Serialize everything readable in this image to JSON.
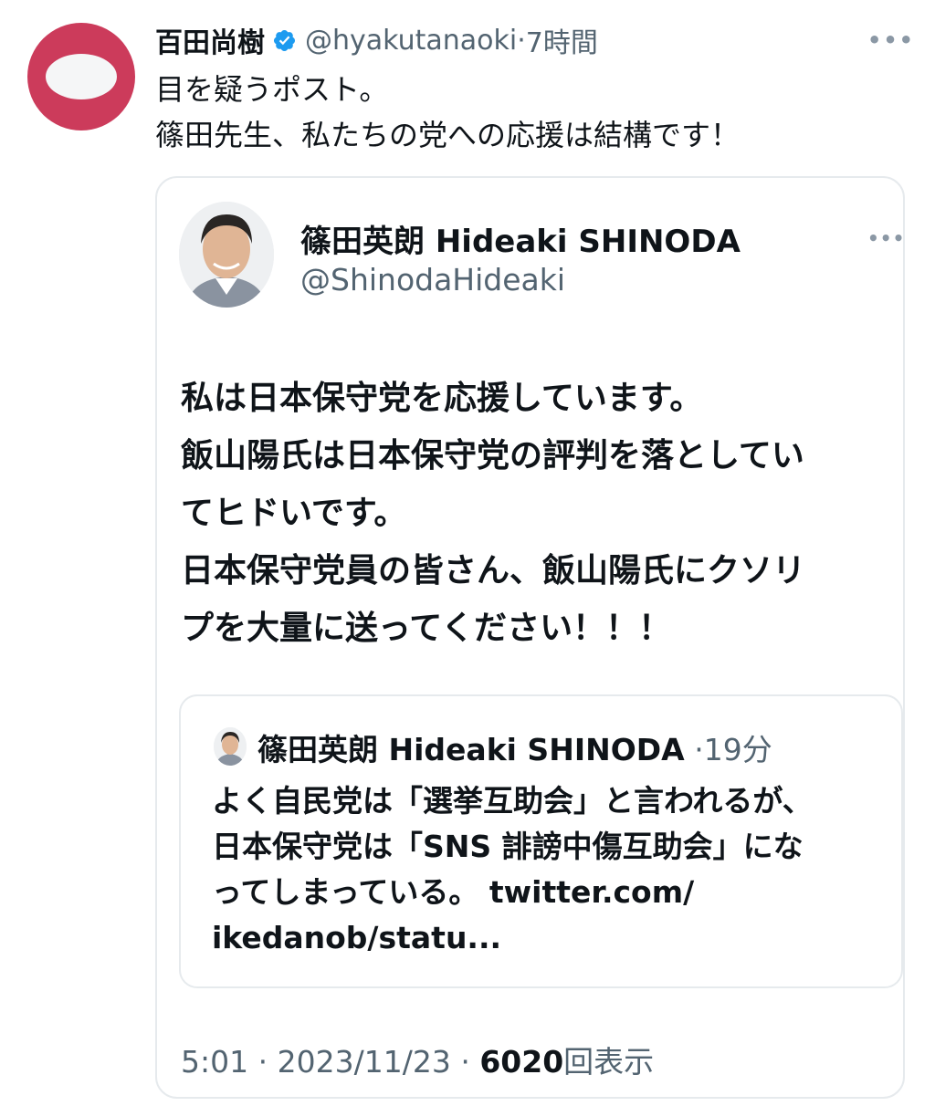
{
  "tweet": {
    "display_name": "百田尚樹",
    "handle": "@hyakutanaoki",
    "time": "7時間",
    "more_icon": "more-horizontal-icon",
    "verified_icon": "verified-badge-icon",
    "accent_color": "#1d9bf0",
    "text_lines": [
      "目を疑うポスト。",
      "篠田先生、私たちの党への応援は結構です！"
    ]
  },
  "quoted": {
    "display_name": "篠田英朗 Hideaki SHINODA",
    "handle": "@ShinodaHideaki",
    "more_icon": "more-horizontal-icon",
    "body_lines": [
      "私は日本保守党を応援しています。",
      "飯山陽氏は日本保守党の評判を落としてい",
      "てヒドいです。",
      "日本保守党員の皆さん、飯山陽氏にクソリ",
      "プを大量に送ってください！！！"
    ],
    "nested": {
      "display_name": "篠田英朗 Hideaki SHINODA",
      "time": "19分",
      "body_lines": [
        "よく自民党は「選挙互助会」と言われるが、",
        "日本保守党は「SNS 誹謗中傷互助会」にな",
        "ってしまっている。 twitter.com/",
        "ikedanob/statu..."
      ]
    },
    "footer": {
      "time": "5:01",
      "date": "2023/11/23",
      "views_count": "6020",
      "views_label": "回表示"
    }
  }
}
